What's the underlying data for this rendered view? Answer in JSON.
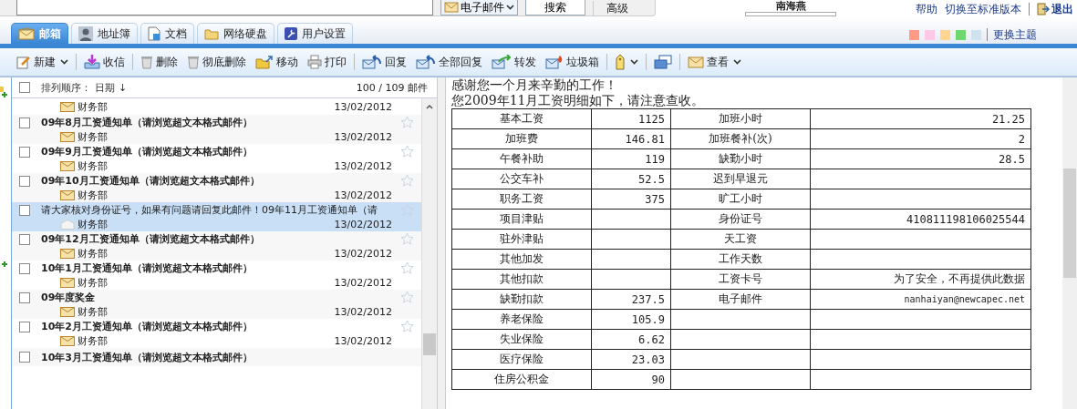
{
  "top_bar": {
    "scope": "电子邮件",
    "search_button": "搜索",
    "advanced": "高级",
    "user": "南海燕",
    "links": [
      "帮助",
      "切换至标准版本"
    ],
    "logout": "退出"
  },
  "tabs": [
    {
      "label": "邮箱",
      "selected": true
    },
    {
      "label": "地址簿",
      "selected": false
    },
    {
      "label": "文档",
      "selected": false
    },
    {
      "label": "网络硬盘",
      "selected": false
    },
    {
      "label": "用户设置",
      "selected": false
    }
  ],
  "themes": {
    "swatches": [
      {
        "color": "#ff9a85"
      },
      {
        "color": "#ffc8e8"
      },
      {
        "color": "#ffd58f"
      },
      {
        "color": "#6ed86e"
      },
      {
        "color": "#cfe3ee"
      }
    ],
    "label": "更换主题"
  },
  "toolbar": [
    {
      "label": "新建",
      "dropdown": true
    },
    {
      "label": "收信",
      "dropdown": false
    },
    {
      "label": "删除",
      "dropdown": false
    },
    {
      "label": "彻底删除",
      "dropdown": false
    },
    {
      "label": "移动",
      "dropdown": false
    },
    {
      "label": "打印",
      "dropdown": false
    },
    {
      "label": "回复",
      "dropdown": false
    },
    {
      "label": "全部回复",
      "dropdown": false
    },
    {
      "label": "转发",
      "dropdown": false
    },
    {
      "label": "垃圾箱",
      "dropdown": false
    },
    {
      "dropdown": true
    },
    {
      "dropdown": false
    },
    {
      "label": "查看",
      "dropdown": true
    }
  ],
  "list": {
    "select_all_checked": false,
    "sort_label": "排列顺序：",
    "sort_field": "日期",
    "sort_arrow": "↓",
    "count": "100 / 109 邮件",
    "first_partial": {
      "sender": "财务部",
      "date": "13/02/2012"
    },
    "messages": [
      {
        "subject": "09年8月工资通知单（请浏览超文本格式邮件）",
        "sender": "财务部",
        "date": "13/02/2012",
        "unread": true,
        "checked": false,
        "selected": false
      },
      {
        "subject": "09年9月工资通知单（请浏览超文本格式邮件）",
        "sender": "财务部",
        "date": "13/02/2012",
        "unread": true,
        "checked": false,
        "selected": false
      },
      {
        "subject": "09年10月工资通知单（请浏览超文本格式邮件）",
        "sender": "财务部",
        "date": "13/02/2012",
        "unread": true,
        "checked": false,
        "selected": false
      },
      {
        "subject": "请大家核对身份证号，如果有问题请回复此邮件！09年11月工资通知单（请",
        "sender": "财务部",
        "date": "13/02/2012",
        "unread": false,
        "checked": false,
        "selected": true
      },
      {
        "subject": "09年12月工资通知单（请浏览超文本格式邮件）",
        "sender": "财务部",
        "date": "13/02/2012",
        "unread": true,
        "checked": false,
        "selected": false
      },
      {
        "subject": "10年1月工资通知单（请浏览超文本格式邮件）",
        "sender": "财务部",
        "date": "13/02/2012",
        "unread": true,
        "checked": false,
        "selected": false
      },
      {
        "subject": "09年度奖金",
        "sender": "财务部",
        "date": "13/02/2012",
        "unread": true,
        "checked": false,
        "selected": false
      },
      {
        "subject": "10年2月工资通知单（请浏览超文本格式邮件）",
        "sender": "财务部",
        "date": "13/02/2012",
        "unread": true,
        "checked": false,
        "selected": false
      }
    ],
    "last_partial": {
      "subject": "10年3月工资通知单（请浏览超文本格式邮件）",
      "checked": false
    }
  },
  "message": {
    "lines": [
      "感谢您一个月来辛勤的工作！",
      "您2009年11月工资明细如下，请注意查收。"
    ],
    "table": [
      {
        "label": "基本工资",
        "value": "1125",
        "label_2": "加班小时",
        "value_2": "21.25"
      },
      {
        "label": "加班费",
        "value": "146.81",
        "label_2": "加班餐补(次)",
        "value_2": "2"
      },
      {
        "label": "午餐补助",
        "value": "119",
        "label_2": "缺勤小时",
        "value_2": "28.5"
      },
      {
        "label": "公交车补",
        "value": "52.5",
        "label_2": "迟到早退元"
      },
      {
        "label": "职务工资",
        "value": "375",
        "label_2": "旷工小时"
      },
      {
        "label": "项目津贴",
        "label_2": "身份证号",
        "value_2": "410811198106025544"
      },
      {
        "label": "驻外津贴",
        "label_2": "天工资"
      },
      {
        "label": "其他加发",
        "label_2": "工作天数"
      },
      {
        "label": "其他扣款",
        "label_2": "工资卡号",
        "value_2": "为了安全，不再提供此数据"
      },
      {
        "label": "缺勤扣款",
        "value": "237.5",
        "label_2": "电子邮件",
        "value_2": "nanhaiyan@newcapec.net",
        "small_value_2": true
      },
      {
        "label": "养老保险",
        "value": "105.9"
      },
      {
        "label": "失业保险",
        "value": "6.62"
      },
      {
        "label": "医疗保险",
        "value": "23.03"
      },
      {
        "label": "住房公积金",
        "value": "90"
      }
    ]
  }
}
